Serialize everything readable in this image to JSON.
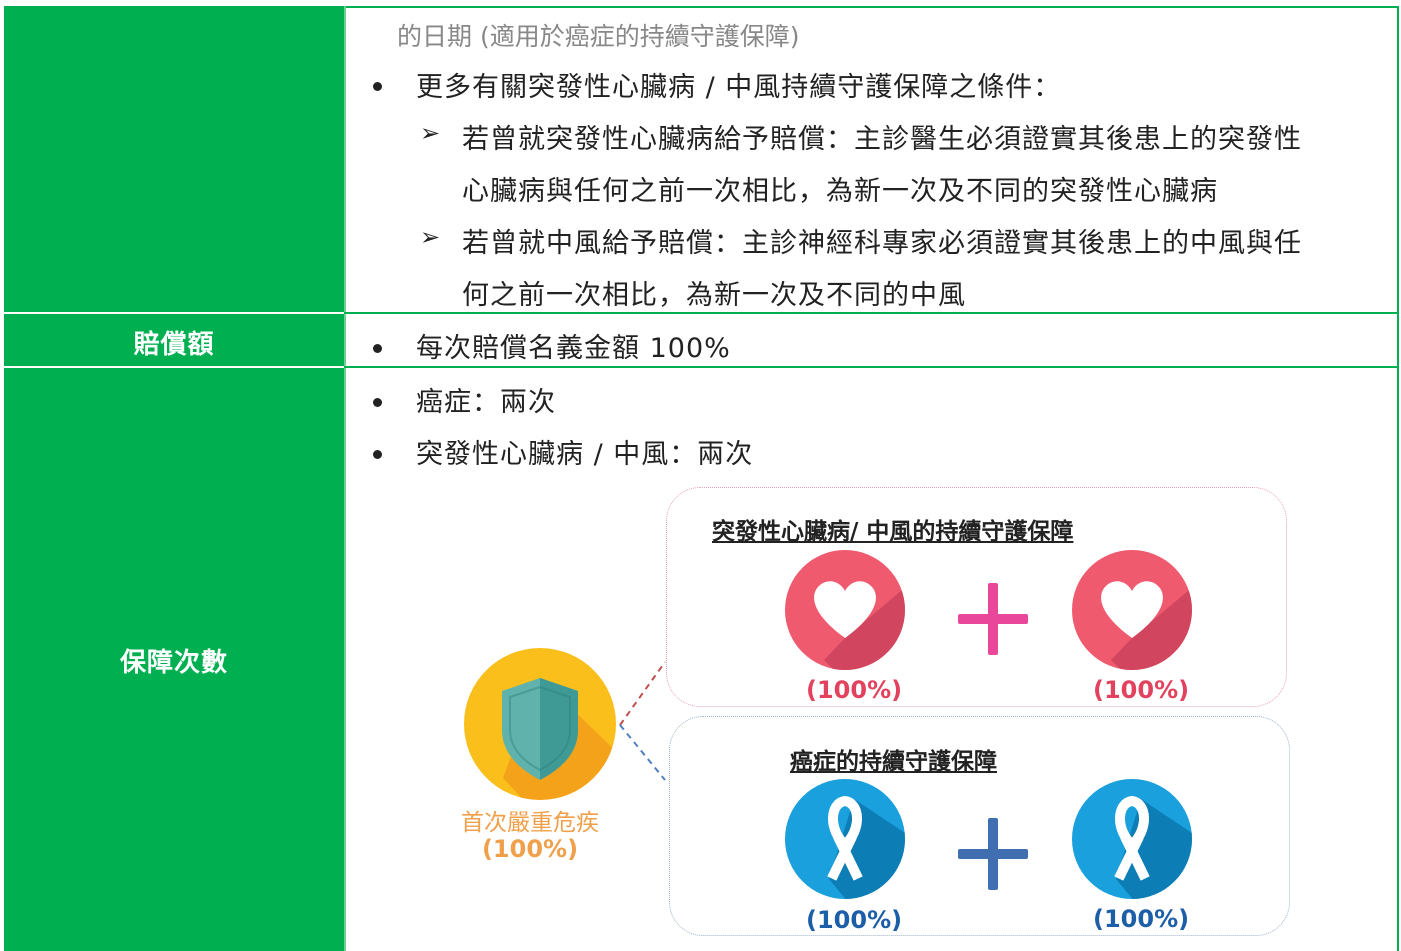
{
  "table": {
    "rows": [
      {
        "label": "",
        "content": {
          "continuation": "的日期 (適用於癌症的持續守護保障)",
          "bullet": "更多有關突發性心臟病 / 中風持續守護保障之條件：",
          "sub_items": [
            {
              "line1": "若曾就突發性心臟病給予賠償：主診醫生必須證實其後患上的突發性",
              "line2": "心臟病與任何之前一次相比，為新一次及不同的突發性心臟病"
            },
            {
              "line1": "若曾就中風給予賠償：主診神經科專家必須證實其後患上的中風與任",
              "line2": "何之前一次相比，為新一次及不同的中風"
            }
          ]
        }
      },
      {
        "label": "賠償額",
        "content": {
          "bullet": "每次賠償名義金額 100%"
        }
      },
      {
        "label": "保障次數",
        "content": {
          "bullets": [
            "癌症：兩次",
            "突發性心臟病 / 中風：兩次"
          ]
        }
      }
    ]
  },
  "diagram": {
    "first_claim": {
      "label": "首次嚴重危疾",
      "percent": "(100%)",
      "icon": "shield-icon"
    },
    "heart_box": {
      "title": "突發性心臟病/ 中風的持續守護保障",
      "left_percent": "(100%)",
      "right_percent": "(100%)",
      "icon": "heart-icon"
    },
    "cancer_box": {
      "title": "癌症的持續守護保障",
      "left_percent": "(100%)",
      "right_percent": "(100%)",
      "icon": "ribbon-icon"
    },
    "colors": {
      "header_green": "#00b050",
      "heart_red": "#ef5a6e",
      "plus_pink": "#e8479a",
      "ribbon_blue": "#1aa0dc",
      "plus_blue": "#3f6fb0",
      "shield_yellow": "#fbbf1c",
      "shield_teal": "#3f9a95"
    }
  }
}
